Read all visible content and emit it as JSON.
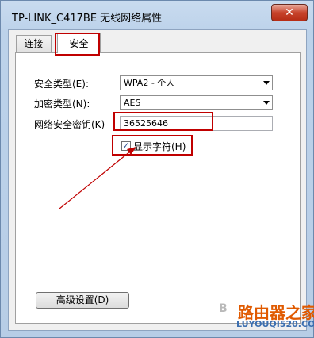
{
  "window": {
    "title": "TP-LINK_C417BE 无线网络属性",
    "close_label": "✕"
  },
  "tabs": [
    {
      "label": "连接"
    },
    {
      "label": "安全"
    }
  ],
  "form": {
    "security_type_label": "安全类型(E):",
    "security_type_value": "WPA2 - 个人",
    "encryption_type_label": "加密类型(N):",
    "encryption_type_value": "AES",
    "key_label": "网络安全密钥(K)",
    "key_value": "36525646",
    "show_chars_label": "显示字符(H)",
    "show_chars_checked": true,
    "checkbox_mark": "✓",
    "advanced_button": "高级设置(D)"
  },
  "watermark": {
    "letter": "B",
    "site_name": "路由器之家",
    "site_url": "LUYOUQI520.COM"
  },
  "colors": {
    "highlight": "#c00000",
    "titlebar": "#bcd2ea",
    "close_button": "#c7432b"
  }
}
